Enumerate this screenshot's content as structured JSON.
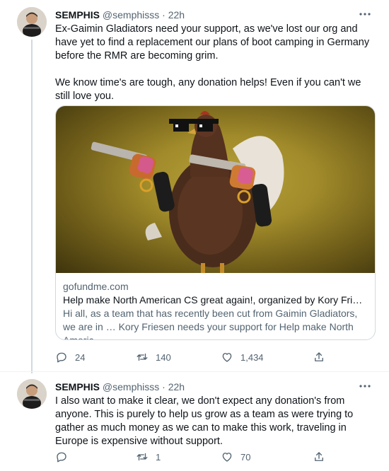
{
  "tweets": [
    {
      "author": {
        "name": "SEMPHIS",
        "handle": "@semphisss",
        "separator": "·",
        "time": "22h"
      },
      "text": "Ex-Gaimin Gladiators need your support, as we've lost our org and have yet to find a replacement our plans of boot camping in Germany before the RMR are becoming grim.\n\nWe know time's are tough, any donation helps! Even if you can't we still love you.",
      "card": {
        "domain": "gofundme.com",
        "title": "Help make North American CS great again!, organized by Kory Friesen",
        "description": "Hi all, as a team that has recently been cut from Gaimin Gladiators, we are in … Kory Friesen needs your support for Help make North Americ…",
        "image_icon": "chicken-with-revolvers-image"
      },
      "actions": {
        "replies": "24",
        "retweets": "140",
        "likes": "1,434"
      }
    },
    {
      "author": {
        "name": "SEMPHIS",
        "handle": "@semphisss",
        "separator": "·",
        "time": "22h"
      },
      "text": "I also want to make it clear, we don't expect any donation's from anyone. This is purely to help us grow as a team as were trying to gather as much money as we can to make this work, traveling in Europe is expensive without support.",
      "actions": {
        "replies": "",
        "retweets": "1",
        "likes": "70"
      }
    }
  ],
  "colors": {
    "text": "#0f1419",
    "secondary": "#536471",
    "border": "#cfd9de"
  },
  "icons": {
    "more": "more-dots-icon",
    "reply": "reply-icon",
    "retweet": "retweet-icon",
    "like": "heart-icon",
    "share": "share-icon"
  }
}
